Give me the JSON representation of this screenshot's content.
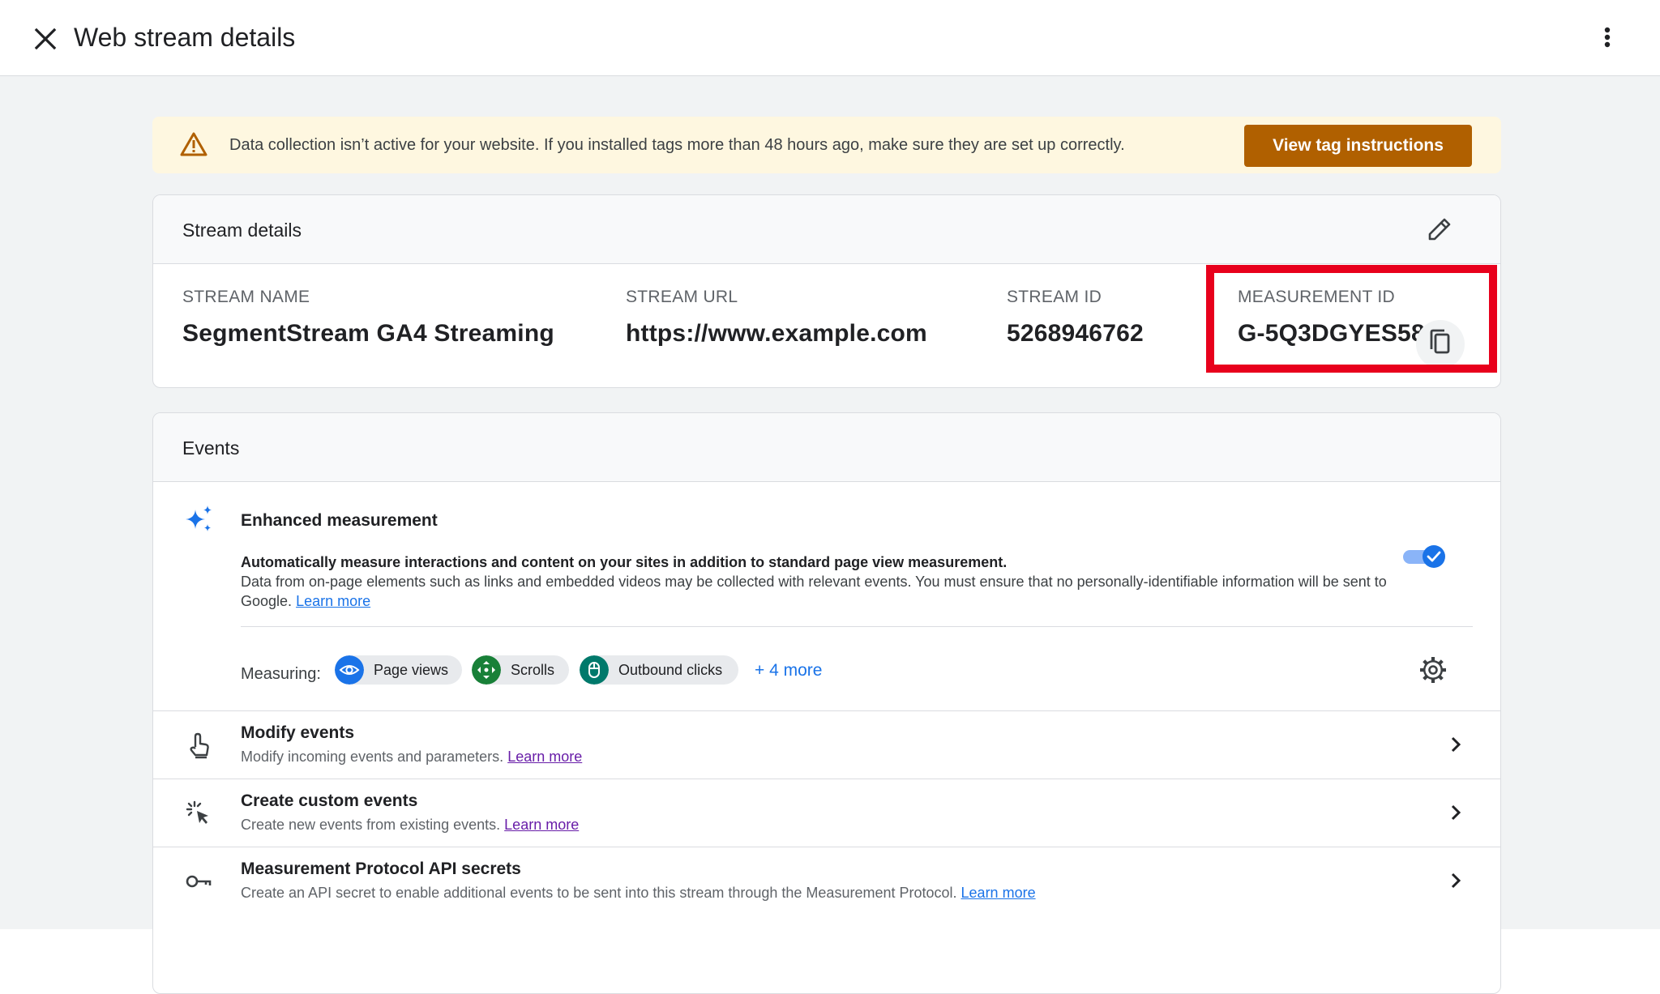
{
  "header": {
    "title": "Web stream details",
    "close_icon": "close-icon",
    "menu_icon": "more-vert-icon"
  },
  "banner": {
    "text": "Data collection isn’t active for your website. If you installed tags more than 48 hours ago, make sure they are set up correctly.",
    "button_label": "View tag instructions",
    "icon": "warning-icon",
    "button_color": "#b06000",
    "background": "#fef7e0"
  },
  "stream_details": {
    "title": "Stream details",
    "edit_icon": "pencil-icon",
    "fields": [
      {
        "label": "STREAM NAME",
        "value": "SegmentStream GA4 Streaming"
      },
      {
        "label": "STREAM URL",
        "value": "https://www.example.com"
      },
      {
        "label": "STREAM ID",
        "value": "5268946762"
      },
      {
        "label": "MEASUREMENT ID",
        "value": "G-5Q3DGYES58"
      }
    ],
    "copy_icon": "copy-icon",
    "highlight_color": "#e8001c"
  },
  "events": {
    "title": "Events",
    "enhanced": {
      "title": "Enhanced measurement",
      "desc_bold": "Automatically measure interactions and content on your sites in addition to standard page view measurement.",
      "desc": "Data from on-page elements such as links and embedded videos may be collected with relevant events. You must ensure that no personally-identifiable information will be sent to Google.",
      "learn_more": "Learn more",
      "toggle_on": true,
      "measuring_label": "Measuring:",
      "chips": [
        {
          "label": "Page views",
          "icon": "eye-icon",
          "color": "#1a73e8"
        },
        {
          "label": "Scrolls",
          "icon": "scroll-arrows-icon",
          "color": "#188038"
        },
        {
          "label": "Outbound clicks",
          "icon": "mouse-icon",
          "color": "#00796b"
        }
      ],
      "more": "+ 4 more",
      "settings_icon": "gear-icon"
    },
    "rows": [
      {
        "title": "Modify events",
        "sub": "Modify incoming events and parameters.",
        "learn_more": "Learn more",
        "icon": "touch-icon"
      },
      {
        "title": "Create custom events",
        "sub": "Create new events from existing events.",
        "learn_more": "Learn more",
        "icon": "click-sparkle-icon"
      },
      {
        "title": "Measurement Protocol API secrets",
        "sub": "Create an API secret to enable additional events to be sent into this stream through the Measurement Protocol.",
        "learn_more": "Learn more",
        "icon": "key-icon"
      }
    ]
  }
}
